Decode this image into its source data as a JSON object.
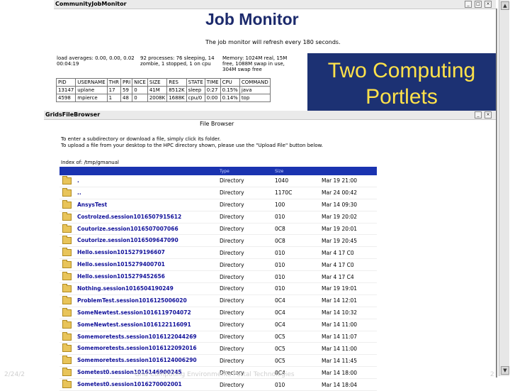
{
  "portlet1": {
    "title": "CommunityJobMonitor",
    "heading": "Job Monitor",
    "refresh_note": "The job monitor will refresh every 180 seconds.",
    "summary": [
      "load averages: 0.00, 0.00, 0.02 00:04:19",
      "92 processes: 76 sleeping, 14 zombie, 1 stopped, 1 on cpu",
      "Memory: 1024M real, 15M free, 1088M swap in use, 304M swap free"
    ],
    "headers": [
      "PID",
      "USERNAME",
      "THR",
      "PRI",
      "NICE",
      "SIZE",
      "RES",
      "STATE",
      "TIME",
      "CPU",
      "COMMAND"
    ],
    "rows": [
      [
        "13147",
        "uplane",
        "17",
        "59",
        "0",
        "41M",
        "8512K",
        "sleep",
        "0:27",
        "0.15%",
        "java"
      ],
      [
        "4598",
        "mpierce",
        "1",
        "48",
        "0",
        "2008K",
        "1688K",
        "cpu/0",
        "0:00",
        "0.14%",
        "top"
      ]
    ]
  },
  "callout": {
    "line1": "Two Computing",
    "line2": "Portlets",
    "bg": "#1c3173",
    "fg": "#ffe24a"
  },
  "portlet2": {
    "title": "GridsFileBrowser",
    "heading": "File Browser",
    "instructions": [
      "To enter a subdirectory or download a file, simply click its folder.",
      "To upload a file from your desktop to the HPC directory shown, please use the \"Upload File\" button below.",
      "Index of: /tmp/gmanual"
    ],
    "col_headers": [
      "",
      "Type",
      "Size",
      ""
    ],
    "rows": [
      {
        "name": ".",
        "type": "Directory",
        "size": "1040",
        "date": "Mar 19 21:00"
      },
      {
        "name": "..",
        "type": "Directory",
        "size": "1170C",
        "date": "Mar 24 00:42"
      },
      {
        "name": "AnsysTest",
        "type": "Directory",
        "size": "100",
        "date": "Mar 14 09:30"
      },
      {
        "name": "Costrolzed.session1016507915612",
        "type": "Directory",
        "size": "010",
        "date": "Mar 19 20:02"
      },
      {
        "name": "Coutorize.session1016507007066",
        "type": "Directory",
        "size": "0C8",
        "date": "Mar 19 20:01"
      },
      {
        "name": "Coutorize.session1016509647090",
        "type": "Directory",
        "size": "0C8",
        "date": "Mar 19 20:45"
      },
      {
        "name": "Hello.session1015279196607",
        "type": "Directory",
        "size": "010",
        "date": "Mar 4 17 C0"
      },
      {
        "name": "Hello.session1015279400701",
        "type": "Directory",
        "size": "010",
        "date": "Mar 4 17 C0"
      },
      {
        "name": "Hello.session1015279452656",
        "type": "Directory",
        "size": "010",
        "date": "Mar 4 17 C4"
      },
      {
        "name": "Nothing.session1016504190249",
        "type": "Directory",
        "size": "010",
        "date": "Mar 19 19:01"
      },
      {
        "name": "ProblemTest.session1016125006020",
        "type": "Directory",
        "size": "0C4",
        "date": "Mar 14 12:01"
      },
      {
        "name": "SomeNewtest.session1016119704072",
        "type": "Directory",
        "size": "0C4",
        "date": "Mar 14 10:32"
      },
      {
        "name": "SomeNewtest.session1016122116091",
        "type": "Directory",
        "size": "0C4",
        "date": "Mar 14 11:00"
      },
      {
        "name": "Somemoretests.session1016122044269",
        "type": "Directory",
        "size": "0C5",
        "date": "Mar 14 11:07"
      },
      {
        "name": "Somemoretests.session1016122092016",
        "type": "Directory",
        "size": "0C5",
        "date": "Mar 14 11:00"
      },
      {
        "name": "Somemoretests.session1016124006290",
        "type": "Directory",
        "size": "0C5",
        "date": "Mar 14 11:45"
      },
      {
        "name": "Sometest0.session1016146900245",
        "type": "Directory",
        "size": "0C4",
        "date": "Mar 14 18:00"
      },
      {
        "name": "Sometest0.session1016270002001",
        "type": "Directory",
        "size": "010",
        "date": "Mar 14 18:04"
      }
    ]
  },
  "footer": {
    "date": "2/24/2",
    "caption": "Grid Computing Environments Portal Technologies",
    "page": "2"
  }
}
